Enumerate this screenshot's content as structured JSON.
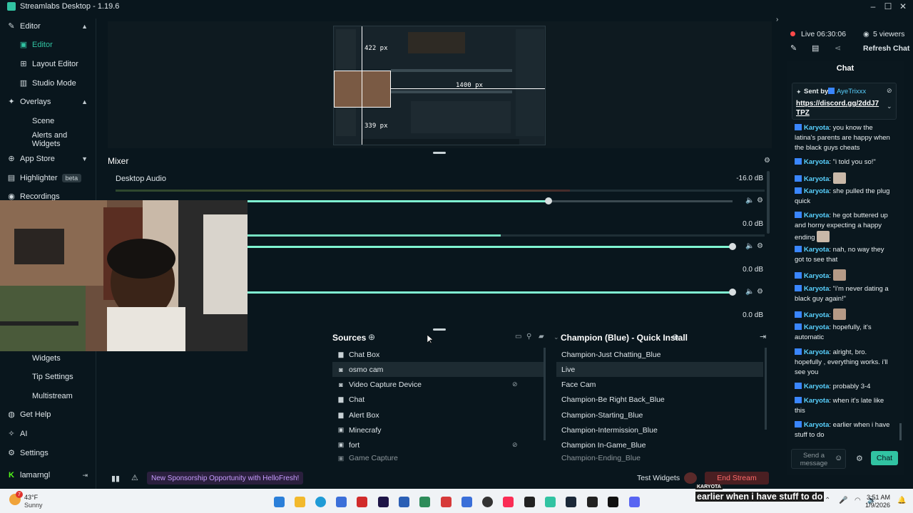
{
  "app": {
    "title": "Streamlabs Desktop - 1.19.6"
  },
  "window_controls": {
    "minimize": "–",
    "maximize": "☐",
    "close": "✕"
  },
  "nav": {
    "editor": "Editor",
    "editor_sub": "Editor",
    "layout_editor": "Layout Editor",
    "studio_mode": "Studio Mode",
    "overlays": "Overlays",
    "scene": "Scene",
    "alerts_widgets": "Alerts and Widgets",
    "app_store": "App Store",
    "highlighter": "Highlighter",
    "highlighter_badge": "beta",
    "recordings": "Recordings",
    "widgets": "Widgets",
    "tip_settings": "Tip Settings",
    "multistream": "Multistream",
    "get_help": "Get Help",
    "ai": "AI",
    "settings": "Settings",
    "user": "lamarngl"
  },
  "preview": {
    "label_top": "422 px",
    "label_right": "1400 px",
    "label_bottom": "339 px"
  },
  "mixer": {
    "title": "Mixer",
    "channels": [
      {
        "name": "Desktop Audio",
        "db": "-16.0 dB",
        "level": 0.62
      },
      {
        "name": "",
        "db": "0.0 dB",
        "level": 1.0
      },
      {
        "name": "",
        "db": "0.0 dB",
        "level": 1.0
      }
    ],
    "channel_extra_db": "0.0 dB"
  },
  "sources": {
    "title": "Sources",
    "items": [
      "Chat Box",
      "osmo cam",
      "Video Capture Device",
      "Chat",
      "Alert Box",
      "Minecrafy",
      "fort"
    ],
    "selected": "osmo cam",
    "partial": "Game Capture"
  },
  "scenes": {
    "title": "Champion (Blue) - Quick Install",
    "items": [
      "Champion-Just Chatting_Blue",
      "Live",
      "Face Cam",
      "Champion-Be Right Back_Blue",
      "Champion-Starting_Blue",
      "Champion-Intermission_Blue",
      "Champion In-Game_Blue"
    ],
    "selected": "Live",
    "partial": "Champion-Ending_Blue"
  },
  "bottom": {
    "sponsor": "New Sponsorship Opportunity with HelloFresh!",
    "test_widgets": "Test Widgets",
    "end_stream": "End Stream"
  },
  "live": {
    "status": "Live 06:30:06",
    "viewers": "5 viewers",
    "refresh": "Refresh Chat"
  },
  "chat": {
    "title": "Chat",
    "pinned_sent_by": "Sent by",
    "pinned_user": "AyeTrixxx",
    "pinned_link": "https://discord.gg/2ddJ7TPZ",
    "messages": [
      {
        "user": "Karyota",
        "text": "you know the latina's parents are happy when the black guys cheats"
      },
      {
        "user": "Karyota",
        "text": "\"i told you so!\""
      },
      {
        "user": "Karyota",
        "text": ""
      },
      {
        "user": "Karyota",
        "text": "she pulled the plug quick"
      },
      {
        "user": "Karyota",
        "text": "he got buttered up and horny expecting a happy ending"
      },
      {
        "user": "Karyota",
        "text": "nah, no way they got to see that"
      },
      {
        "user": "Karyota",
        "text": ""
      },
      {
        "user": "Karyota",
        "text": "\"i'm never dating a black guy again!\""
      },
      {
        "user": "Karyota",
        "text": ""
      },
      {
        "user": "Karyota",
        "text": "hopefully, it's automatic"
      },
      {
        "user": "Karyota",
        "text": "alright, bro. hopefully , everything works. i'll see you"
      },
      {
        "user": "Karyota",
        "text": "probably 3-4"
      },
      {
        "user": "Karyota",
        "text": "when it's late like this"
      },
      {
        "user": "Karyota",
        "text": "earlier when i have stuff to do"
      }
    ],
    "input_placeholder": "Send a message",
    "send_label": "Chat"
  },
  "overlay_caption": {
    "user": "KARYOTA",
    "text": "earlier when i have stuff to do"
  },
  "taskbar": {
    "weather_temp": "43°F",
    "weather_desc": "Sunny",
    "weather_badge": "7",
    "time": "3:51 AM",
    "date": "1/9/2026"
  }
}
